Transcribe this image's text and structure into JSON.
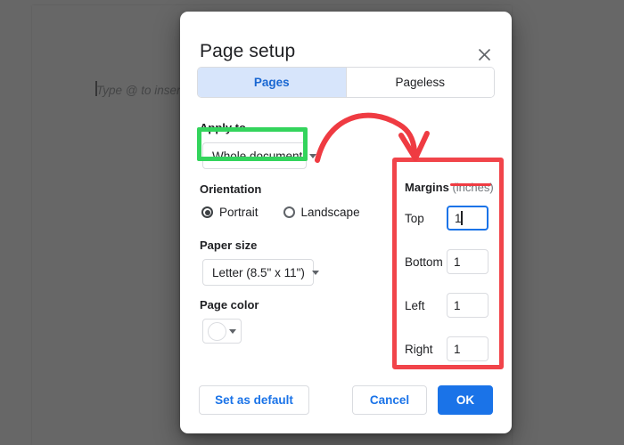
{
  "background": {
    "placeholder_text": "Type @ to insert"
  },
  "dialog": {
    "title": "Page setup",
    "close_icon": "close-icon",
    "view_toggle": {
      "options": [
        "Pages",
        "Pageless"
      ],
      "selected": "Pages"
    },
    "apply_to": {
      "label": "Apply to",
      "value": "Whole document",
      "caret_icon": "chevron-down-icon"
    },
    "orientation": {
      "label": "Orientation",
      "options": [
        "Portrait",
        "Landscape"
      ],
      "selected": "Portrait"
    },
    "paper_size": {
      "label": "Paper size",
      "value": "Letter (8.5\" x 11\")",
      "caret_icon": "chevron-down-icon"
    },
    "page_color": {
      "label": "Page color",
      "swatch_color": "#ffffff",
      "caret_icon": "chevron-down-icon"
    },
    "margins": {
      "title": "Margins",
      "unit_label": "(inches)",
      "fields": [
        {
          "label": "Top",
          "value": "1",
          "focused": true
        },
        {
          "label": "Bottom",
          "value": "1",
          "focused": false
        },
        {
          "label": "Left",
          "value": "1",
          "focused": false
        },
        {
          "label": "Right",
          "value": "1",
          "focused": false
        }
      ]
    },
    "footer": {
      "set_default_label": "Set as default",
      "cancel_label": "Cancel",
      "ok_label": "OK"
    }
  },
  "annotations": {
    "green_highlight_color": "#33d45c",
    "red_highlight_color": "#f1444a",
    "arrow_color": "#ef3b42"
  },
  "theme": {
    "accent_blue": "#1a73e8",
    "tab_active_bg": "#d7e5fb",
    "tab_active_text": "#1967d2",
    "text_primary": "#202124",
    "text_muted": "#70757a",
    "border": "#dadce0",
    "scrim": "rgba(60,60,60,0.78)"
  }
}
